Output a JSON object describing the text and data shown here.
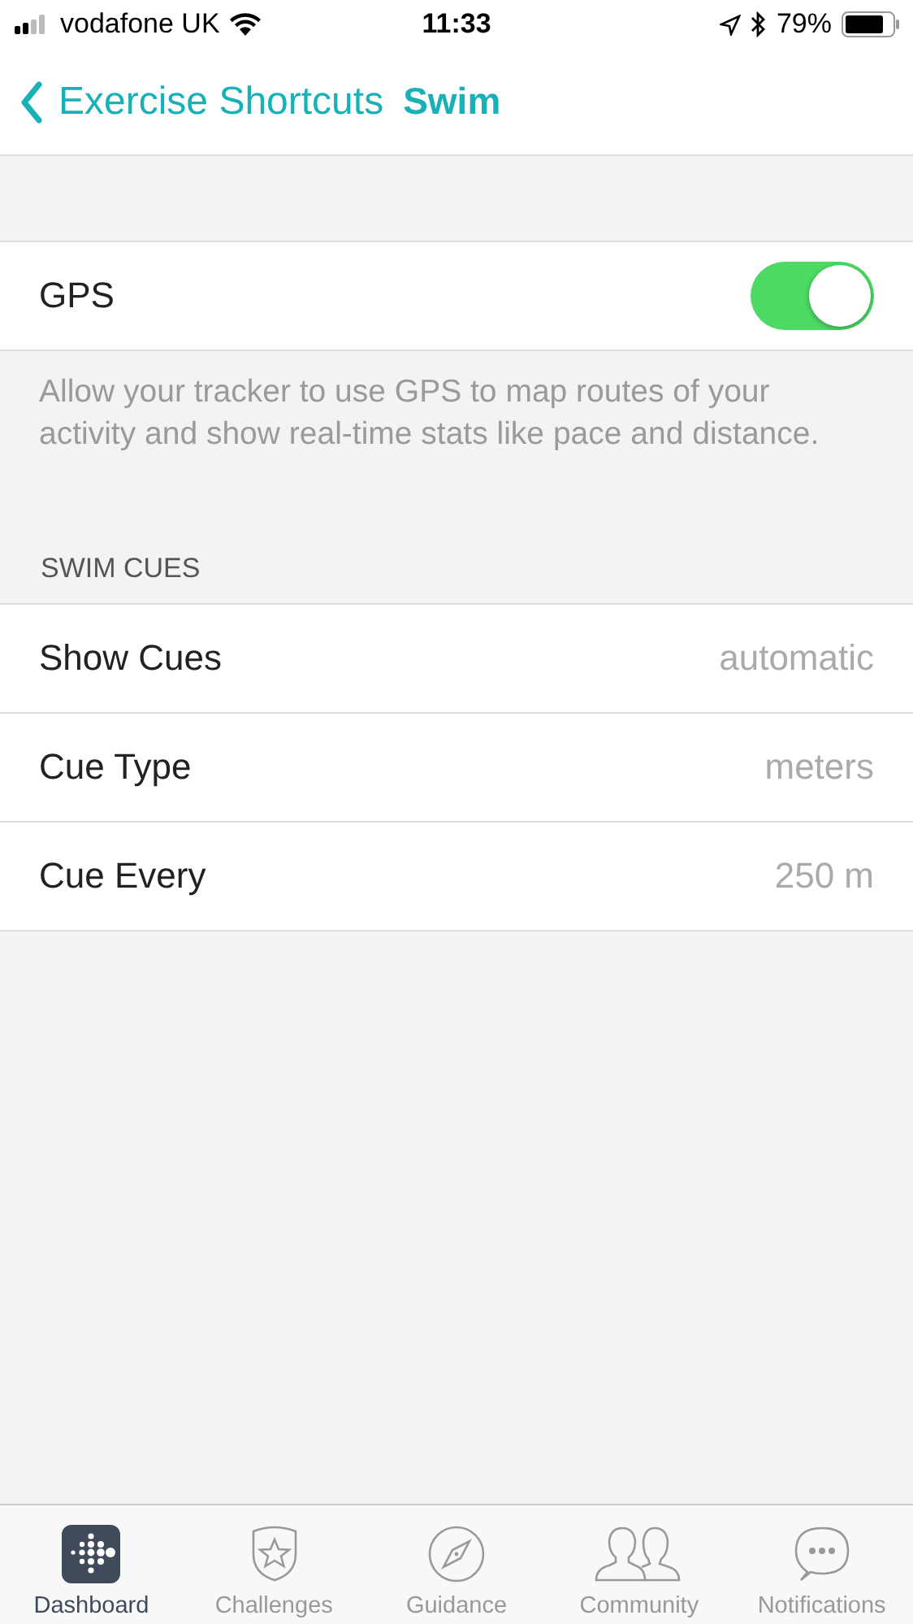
{
  "status_bar": {
    "carrier": "vodafone UK",
    "time": "11:33",
    "battery": "79%"
  },
  "nav": {
    "back": "Exercise Shortcuts",
    "title": "Swim"
  },
  "gps": {
    "label": "GPS",
    "on": true,
    "description": "Allow your tracker to use GPS to map routes of your activity and show real-time stats like pace and distance."
  },
  "section": {
    "header": "SWIM CUES",
    "rows": [
      {
        "label": "Show Cues",
        "value": "automatic"
      },
      {
        "label": "Cue Type",
        "value": "meters"
      },
      {
        "label": "Cue Every",
        "value": "250 m"
      }
    ]
  },
  "tabs": [
    {
      "label": "Dashboard",
      "selected": true
    },
    {
      "label": "Challenges",
      "selected": false
    },
    {
      "label": "Guidance",
      "selected": false
    },
    {
      "label": "Community",
      "selected": false
    },
    {
      "label": "Notifications",
      "selected": false
    }
  ]
}
